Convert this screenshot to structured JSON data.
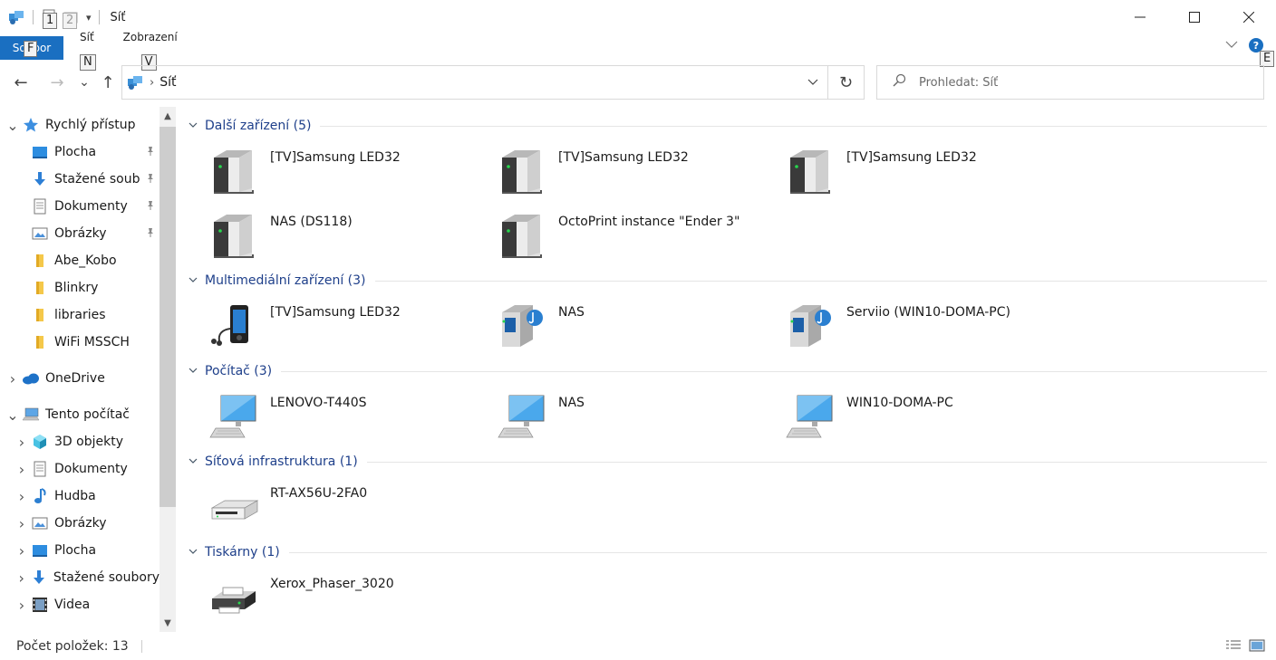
{
  "window": {
    "title": "Síť",
    "minimize": "—",
    "maximize": "☐",
    "close": "✕"
  },
  "quick_access_toolbar": {
    "keytip_1": "1",
    "keytip_2": "2",
    "dropdown": "▾"
  },
  "ribbon": {
    "file_tab": "Soubor",
    "file_keytip": "F",
    "tabs": [
      {
        "label": "Síť",
        "keytip": "N"
      },
      {
        "label": "Zobrazení",
        "keytip": "V"
      }
    ],
    "help_keytip": "E",
    "help": "?"
  },
  "address_bar": {
    "back": "←",
    "forward": "→",
    "recent": "⌄",
    "up": "↑",
    "separator": "›",
    "path": "Síť",
    "dropdown": "⌄",
    "refresh": "↻"
  },
  "search": {
    "placeholder": "Prohledat: Síť"
  },
  "nav_pane": {
    "items": [
      {
        "label": "Rychlý přístup",
        "icon": "star-icon",
        "level": 0,
        "expanded": true,
        "pinned": false
      },
      {
        "label": "Plocha",
        "icon": "desktop-icon",
        "level": 1,
        "pinned": true
      },
      {
        "label": "Stažené soub",
        "icon": "download-icon",
        "level": 1,
        "pinned": true
      },
      {
        "label": "Dokumenty",
        "icon": "document-icon",
        "level": 1,
        "pinned": true
      },
      {
        "label": "Obrázky",
        "icon": "pictures-icon",
        "level": 1,
        "pinned": true
      },
      {
        "label": "Abe_Kobo",
        "icon": "folder-icon",
        "level": 1,
        "pinned": false
      },
      {
        "label": "Blinkry",
        "icon": "folder-icon",
        "level": 1,
        "pinned": false
      },
      {
        "label": "libraries",
        "icon": "folder-icon",
        "level": 1,
        "pinned": false
      },
      {
        "label": "WiFi MSSCH",
        "icon": "folder-icon",
        "level": 1,
        "pinned": false
      },
      {
        "label": "OneDrive",
        "icon": "cloud-icon",
        "level": 0,
        "expanded": false
      },
      {
        "label": "Tento počítač",
        "icon": "pc-icon",
        "level": 0,
        "expanded": true
      },
      {
        "label": "3D objekty",
        "icon": "cube-icon",
        "level": 1,
        "expanded": false
      },
      {
        "label": "Dokumenty",
        "icon": "document-icon",
        "level": 1,
        "expanded": false
      },
      {
        "label": "Hudba",
        "icon": "music-icon",
        "level": 1,
        "expanded": false
      },
      {
        "label": "Obrázky",
        "icon": "pictures-icon",
        "level": 1,
        "expanded": false
      },
      {
        "label": "Plocha",
        "icon": "desktop-icon",
        "level": 1,
        "expanded": false
      },
      {
        "label": "Stažené soubory",
        "icon": "download-icon",
        "level": 1,
        "expanded": false
      },
      {
        "label": "Videa",
        "icon": "video-icon",
        "level": 1,
        "expanded": false
      }
    ]
  },
  "groups": [
    {
      "title": "Další zařízení (5)",
      "items": [
        {
          "name": "[TV]Samsung LED32",
          "icon": "server-icon"
        },
        {
          "name": "[TV]Samsung LED32",
          "icon": "server-icon"
        },
        {
          "name": "[TV]Samsung LED32",
          "icon": "server-icon"
        },
        {
          "name": "NAS (DS118)",
          "icon": "server-icon"
        },
        {
          "name": "OctoPrint instance \"Ender 3\"",
          "icon": "server-icon"
        }
      ]
    },
    {
      "title": "Multimediální zařízení (3)",
      "items": [
        {
          "name": "[TV]Samsung LED32",
          "icon": "media-player-icon"
        },
        {
          "name": "NAS",
          "icon": "media-server-icon"
        },
        {
          "name": "Serviio (WIN10-DOMA-PC)",
          "icon": "media-server-icon"
        }
      ]
    },
    {
      "title": "Počítač (3)",
      "items": [
        {
          "name": "LENOVO-T440S",
          "icon": "computer-icon"
        },
        {
          "name": "NAS",
          "icon": "computer-icon"
        },
        {
          "name": "WIN10-DOMA-PC",
          "icon": "computer-icon"
        }
      ]
    },
    {
      "title": "Síťová infrastruktura (1)",
      "items": [
        {
          "name": "RT-AX56U-2FA0",
          "icon": "router-icon"
        }
      ]
    },
    {
      "title": "Tiskárny (1)",
      "items": [
        {
          "name": "Xerox_Phaser_3020",
          "icon": "printer-icon"
        }
      ]
    }
  ],
  "status_bar": {
    "item_count": "Počet položek: 13"
  },
  "colors": {
    "accent": "#1a6fc1",
    "group_title": "#1e3f8a"
  }
}
